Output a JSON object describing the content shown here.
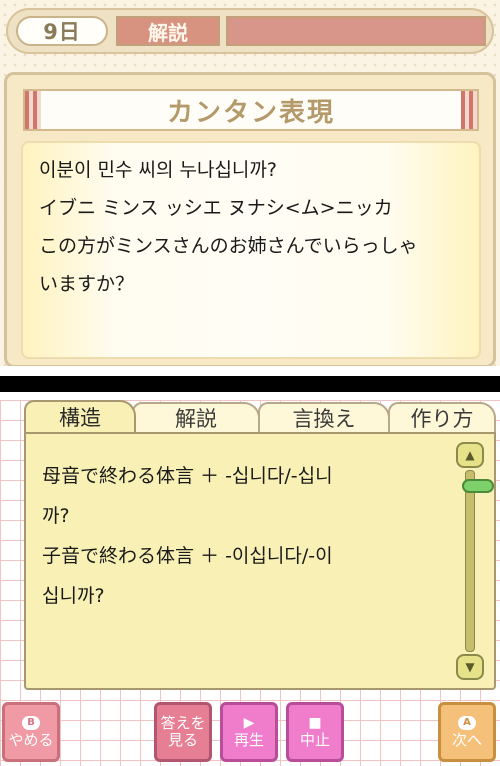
{
  "header": {
    "day": "9日",
    "section": "解説"
  },
  "expression": {
    "title": "カンタン表現",
    "lines": [
      "이분이 민수 씨의 누나십니까?",
      "イブニ ミンス ッシエ ヌナシ<ム>ニッカ",
      "この方がミンスさんのお姉さんでいらっしゃ",
      "いますか？"
    ]
  },
  "tabs": [
    {
      "label": "構造",
      "active": true
    },
    {
      "label": "解説",
      "active": false
    },
    {
      "label": "言換え",
      "active": false
    },
    {
      "label": "作り方",
      "active": false
    }
  ],
  "content": {
    "lines": [
      "母音で終わる体言 ＋ -십니다/-십니",
      "까?",
      "子音で終わる体言 ＋ -이십니다/-이",
      "십니까?"
    ]
  },
  "buttons": {
    "quit": {
      "key": "B",
      "label": "やめる"
    },
    "show_answer": {
      "line1": "答えを",
      "line2": "見る"
    },
    "play": {
      "symbol": "▶",
      "label": "再生"
    },
    "stop": {
      "symbol": "■",
      "label": "中止"
    },
    "next": {
      "key": "A",
      "label": "次へ"
    }
  },
  "colors": {
    "accent_pink": "#ef9aa4",
    "play_magenta": "#f07ccc",
    "next_orange": "#f5c07a",
    "panel_cream": "#f7e8c6"
  }
}
